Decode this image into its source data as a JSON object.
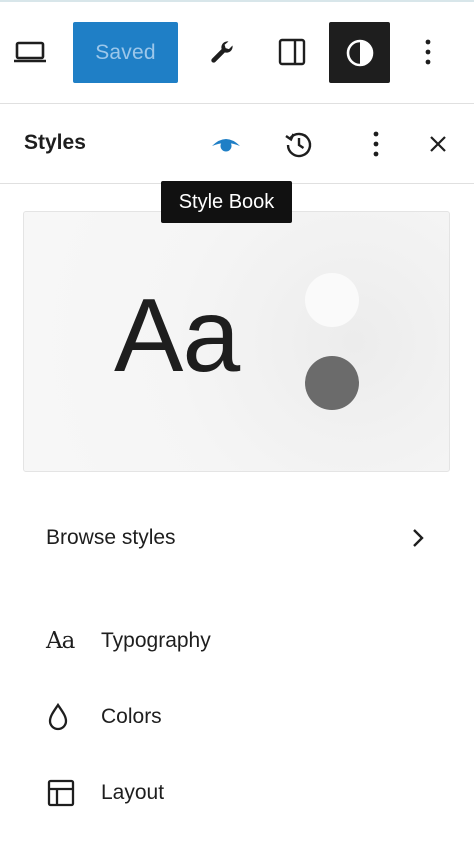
{
  "toolbar": {
    "saved_label": "Saved",
    "icons": [
      "desktop-icon",
      "wrench-icon",
      "sidebar-icon",
      "styles-contrast-icon",
      "more-vertical-icon"
    ]
  },
  "panel": {
    "title": "Styles",
    "icons": [
      "eye-icon",
      "revisions-icon",
      "more-vertical-icon",
      "close-icon"
    ]
  },
  "tooltip": {
    "text": "Style Book"
  },
  "preview": {
    "sample_text": "Aa",
    "colors": {
      "light_dot": "#fafafa",
      "dark_dot": "#6b6b6b"
    }
  },
  "browse": {
    "label": "Browse styles"
  },
  "nav": {
    "items": [
      {
        "label": "Typography",
        "icon": "typography-icon",
        "glyph": "Aa"
      },
      {
        "label": "Colors",
        "icon": "droplet-icon"
      },
      {
        "label": "Layout",
        "icon": "layout-icon"
      }
    ]
  },
  "theme": {
    "accent": "#1f7fc6",
    "eye_color": "#1f7fc6",
    "dark": "#1e1e1e"
  }
}
